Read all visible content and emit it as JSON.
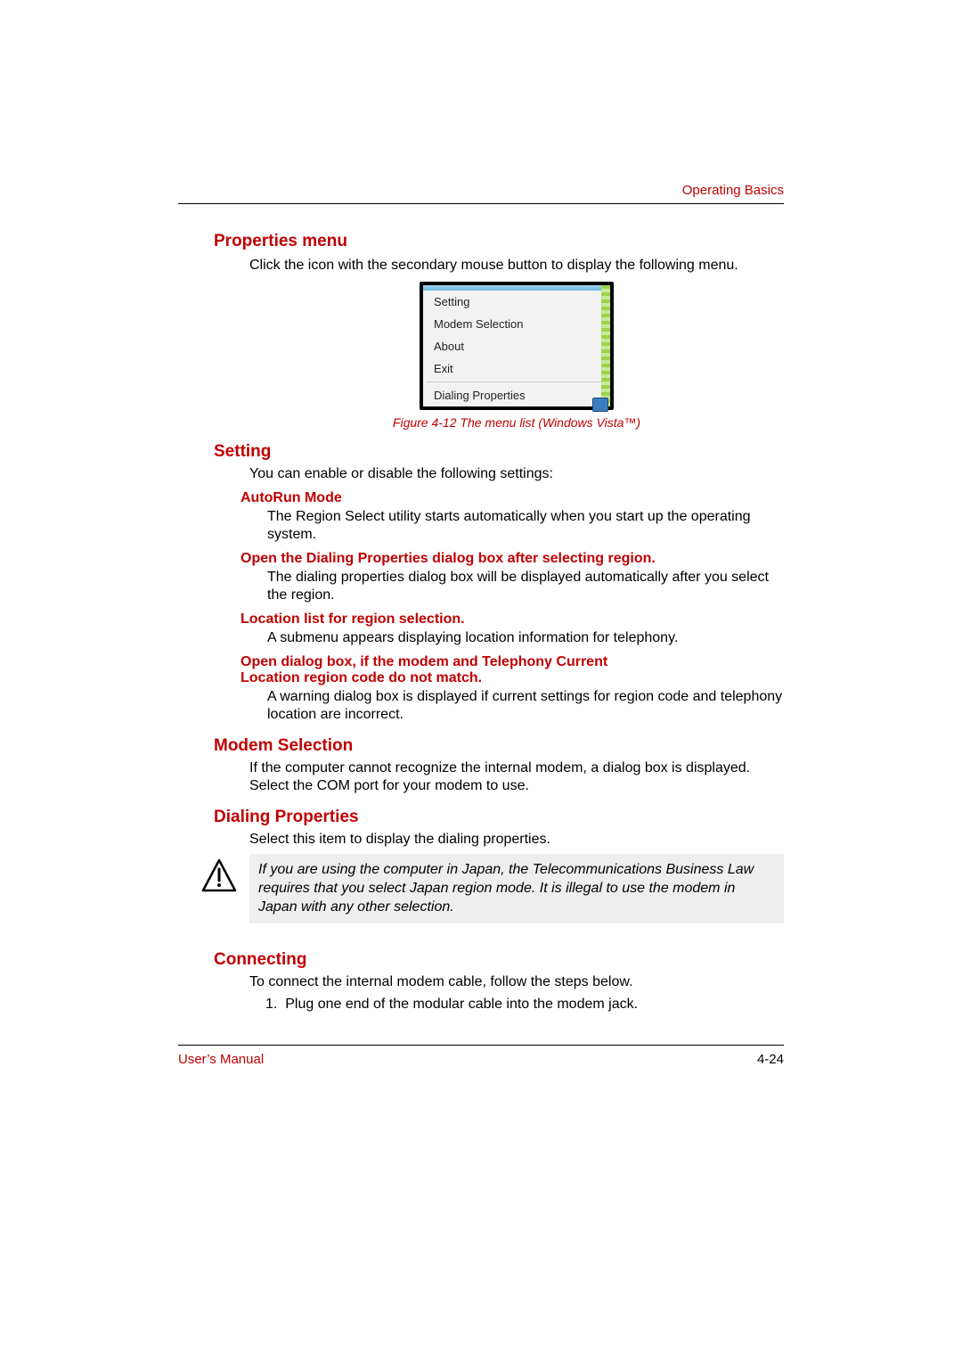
{
  "header": {
    "section": "Operating Basics"
  },
  "section1": {
    "title": "Properties menu",
    "intro": "Click the icon with the secondary mouse button to display the following menu."
  },
  "menu": {
    "items": [
      "Setting",
      "Modem Selection",
      "About",
      "Exit"
    ],
    "footer_item": "Dialing Properties"
  },
  "figure": {
    "caption": "Figure 4-12 The menu list (Windows Vista™)"
  },
  "setting": {
    "title": "Setting",
    "intro": "You can enable or disable the following settings:",
    "autorun": {
      "title": "AutoRun Mode",
      "body": "The Region Select utility starts automatically when you start up the operating system."
    },
    "opendialing": {
      "title": "Open the Dialing Properties dialog box after selecting region.",
      "body": "The dialing properties dialog box will be displayed automatically after you select the region."
    },
    "locationlist": {
      "title": "Location list for region selection.",
      "body": "A submenu appears displaying location information for telephony."
    },
    "mismatch": {
      "title_line1": "Open dialog box, if the modem and Telephony Current",
      "title_line2": "Location region code do not match.",
      "body": "A warning dialog box is displayed if current settings for region code and telephony location are incorrect."
    }
  },
  "modem": {
    "title": "Modem Selection",
    "body": "If the computer cannot recognize the internal modem, a dialog box is displayed. Select the COM port for your modem to use."
  },
  "dialing": {
    "title": "Dialing Properties",
    "body": "Select this item to display the dialing properties."
  },
  "callout": {
    "text": "If you are using the computer in Japan, the Telecommunications Business Law requires that you select Japan region mode. It is illegal to use the modem in Japan with any other selection."
  },
  "connecting": {
    "title": "Connecting",
    "intro": "To connect the internal modem cable, follow the steps below.",
    "step1_num": "1.",
    "step1": "Plug one end of the modular cable into the modem jack."
  },
  "footer": {
    "left": "User’s Manual",
    "right": "4-24"
  }
}
